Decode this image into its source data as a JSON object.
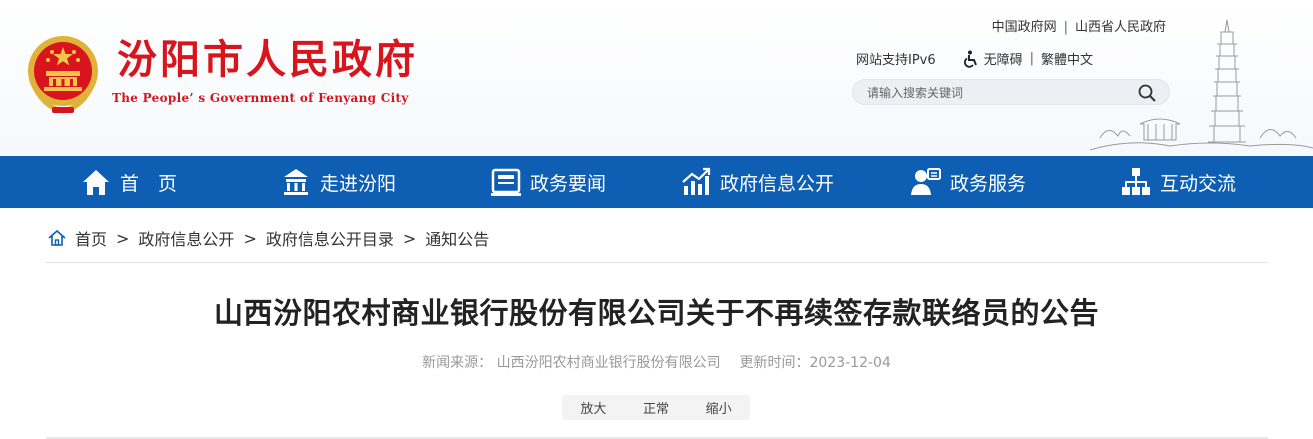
{
  "header": {
    "title": "汾阳市人民政府",
    "subtitle": "The People’ s Government of Fenyang City",
    "top_links": [
      "中国政府网",
      "山西省人民政府"
    ],
    "ipv6": "网站支持IPv6",
    "accessibility": "无障碍",
    "traditional": "繁體中文",
    "search_placeholder": "请输入搜索关键词"
  },
  "nav": {
    "items": [
      {
        "label": "首　页",
        "icon": "home-icon"
      },
      {
        "label": "走进汾阳",
        "icon": "building-icon"
      },
      {
        "label": "政务要闻",
        "icon": "news-icon"
      },
      {
        "label": "政府信息公开",
        "icon": "chart-icon"
      },
      {
        "label": "政务服务",
        "icon": "service-icon"
      },
      {
        "label": "互动交流",
        "icon": "network-icon"
      }
    ]
  },
  "breadcrumb": [
    "首页",
    "政府信息公开",
    "政府信息公开目录",
    "通知公告"
  ],
  "article": {
    "title": "山西汾阳农村商业银行股份有限公司关于不再续签存款联络员的公告",
    "source_label": "新闻来源：",
    "source": "山西汾阳农村商业银行股份有限公司",
    "updated_label": "更新时间：",
    "updated": "2023-12-04",
    "font_sizes": [
      "放大",
      "正常",
      "缩小"
    ]
  },
  "colors": {
    "brand_red": "#d8141d",
    "nav_blue": "#0e5fb3"
  }
}
